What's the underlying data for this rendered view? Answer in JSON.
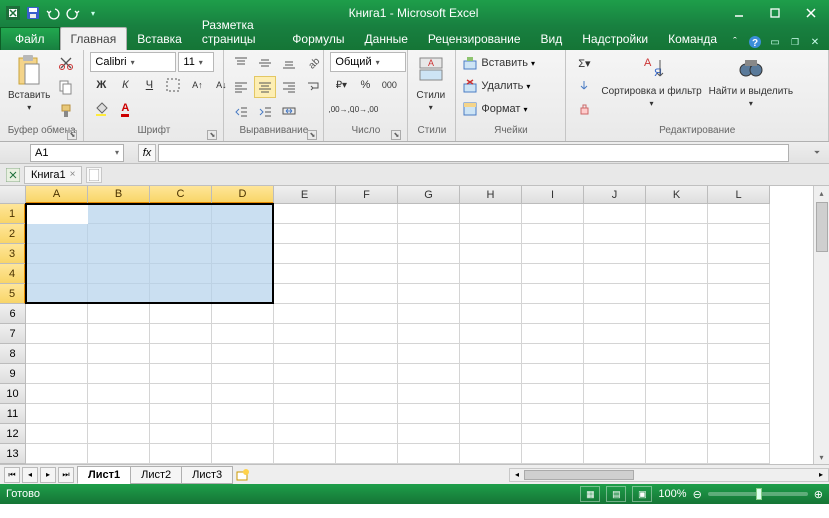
{
  "title": "Книга1 - Microsoft Excel",
  "tabs": {
    "file": "Файл",
    "home": "Главная",
    "insert": "Вставка",
    "page": "Разметка страницы",
    "formulas": "Формулы",
    "data": "Данные",
    "review": "Рецензирование",
    "view": "Вид",
    "addins": "Надстройки",
    "team": "Команда"
  },
  "groups": {
    "clipboard": "Буфер обмена",
    "font": "Шрифт",
    "alignment": "Выравнивание",
    "number": "Число",
    "styles": "Стили",
    "cells": "Ячейки",
    "editing": "Редактирование"
  },
  "clipboard": {
    "paste": "Вставить"
  },
  "font": {
    "name": "Calibri",
    "size": "11",
    "bold": "Ж",
    "italic": "К",
    "underline": "Ч"
  },
  "number": {
    "format": "Общий"
  },
  "styles": {
    "btn": "Стили"
  },
  "cells": {
    "insert": "Вставить",
    "delete": "Удалить",
    "format": "Формат"
  },
  "editing": {
    "sort": "Сортировка и фильтр",
    "find": "Найти и выделить"
  },
  "namebox": "A1",
  "fx": "fx",
  "doc_tab": "Книга1",
  "columns": [
    "A",
    "B",
    "C",
    "D",
    "E",
    "F",
    "G",
    "H",
    "I",
    "J",
    "K",
    "L"
  ],
  "rows": [
    "1",
    "2",
    "3",
    "4",
    "5",
    "6",
    "7",
    "8",
    "9",
    "10",
    "11",
    "12",
    "13"
  ],
  "selected_cols": [
    "A",
    "B",
    "C",
    "D"
  ],
  "selected_rows": [
    "1",
    "2",
    "3",
    "4",
    "5"
  ],
  "sheets": [
    "Лист1",
    "Лист2",
    "Лист3"
  ],
  "active_sheet": "Лист1",
  "status": "Готово",
  "zoom": "100%"
}
